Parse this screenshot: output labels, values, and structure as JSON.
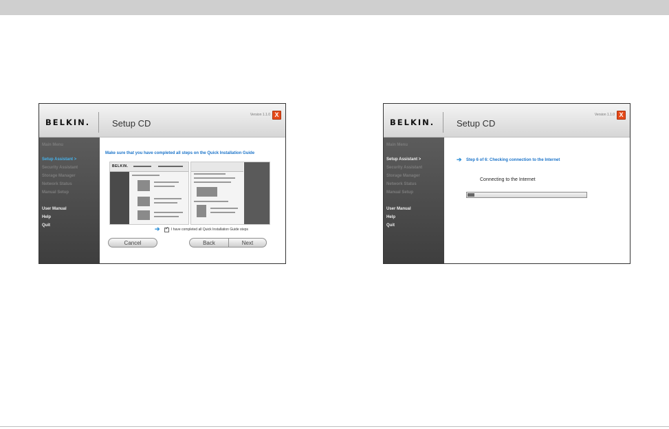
{
  "left_window": {
    "logo": "BELKIN.",
    "title": "Setup CD",
    "version": "Version 1.1.0",
    "close": "X",
    "sidebar": {
      "main_menu": "Main Menu",
      "setup_assistant": "Setup Assistant  >",
      "security_assistant": "Security Assistant",
      "storage_manager": "Storage Manager",
      "network_status": "Network Status",
      "manual_setup": "Manual Setup",
      "user_manual": "User Manual",
      "help": "Help",
      "quit": "Quit"
    },
    "instruction": "Make sure that you have completed all steps on the Quick Installation Guide",
    "guide_logo": "BELKIN.",
    "arrow": "➔",
    "checkbox_label": "I have completed all Quick Installation Guide steps",
    "checkbox_checked": true,
    "check_mark": "✓",
    "buttons": {
      "cancel": "Cancel",
      "back": "Back",
      "next": "Next"
    }
  },
  "right_window": {
    "logo": "BELKIN.",
    "title": "Setup CD",
    "version": "Version 1.1.0",
    "close": "X",
    "sidebar": {
      "main_menu": "Main Menu",
      "setup_assistant": "Setup Assistant  >",
      "security_assistant": "Security Assistant",
      "storage_manager": "Storage Manager",
      "network_status": "Network Status",
      "manual_setup": "Manual Setup",
      "user_manual": "User Manual",
      "help": "Help",
      "quit": "Quit"
    },
    "arrow": "➔",
    "step_text": "Step 6 of 6: Checking connection to the Internet",
    "status_text": "Connecting to the Internet",
    "progress_fraction": 0.06
  },
  "colors": {
    "accent_blue": "#1a73c9",
    "sidebar_active": "#46b3ec",
    "close_red": "#e64a19"
  }
}
